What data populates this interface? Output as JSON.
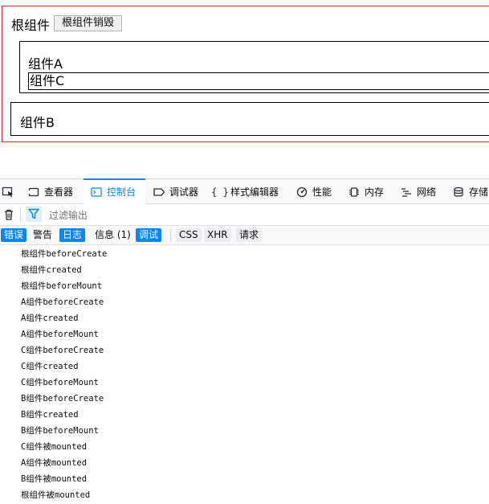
{
  "app": {
    "root_title": "根组件",
    "destroy_button": "根组件销毁",
    "component_a": "组件A",
    "component_c": "组件C",
    "component_b": "组件B"
  },
  "devtools": {
    "tabs": [
      {
        "label": "查看器",
        "icon": "inspector-icon"
      },
      {
        "label": "控制台",
        "icon": "console-icon",
        "active": true
      },
      {
        "label": "调试器",
        "icon": "debugger-icon"
      },
      {
        "label": "样式编辑器",
        "icon": "style-editor-icon"
      },
      {
        "label": "性能",
        "icon": "performance-icon"
      },
      {
        "label": "内存",
        "icon": "memory-icon"
      },
      {
        "label": "网络",
        "icon": "network-icon"
      },
      {
        "label": "存储",
        "icon": "storage-icon"
      }
    ],
    "filter_placeholder": "过滤输出",
    "levels": [
      {
        "label": "错误",
        "on": true
      },
      {
        "label": "警告",
        "on": false
      },
      {
        "label": "日志",
        "on": true
      },
      {
        "label": "信息 (1)",
        "on": false
      },
      {
        "label": "调试",
        "on": true
      },
      {
        "label": "CSS",
        "on": false
      },
      {
        "label": "XHR",
        "on": false
      },
      {
        "label": "请求",
        "on": false
      }
    ],
    "logs": [
      "根组件beforeCreate",
      "根组件created",
      "根组件beforeMount",
      "A组件beforeCreate",
      "A组件created",
      "A组件beforeMount",
      "C组件beforeCreate",
      "C组件created",
      "C组件beforeMount",
      "B组件beforeCreate",
      "B组件created",
      "B组件beforeMount",
      "C组件被mounted",
      "A组件被mounted",
      "B组件被mounted",
      "根组件被mounted"
    ],
    "accent_color": "#0a84ff"
  }
}
